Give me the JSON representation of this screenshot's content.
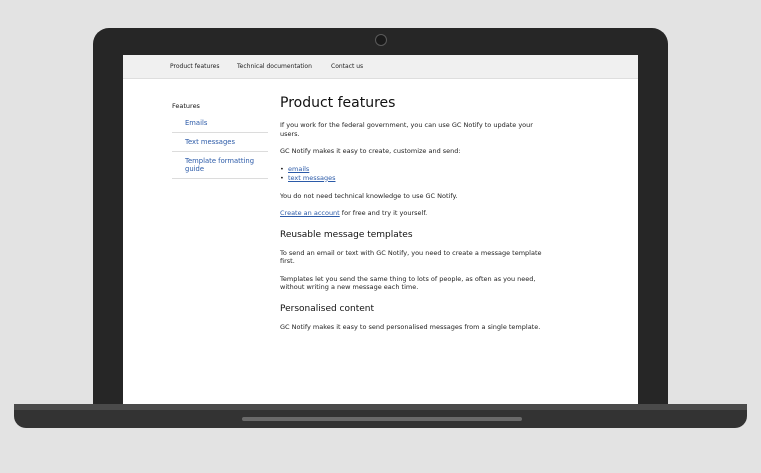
{
  "nav": {
    "items": [
      "Product features",
      "Technical documentation",
      "Contact us"
    ]
  },
  "sidebar": {
    "title": "Features",
    "items": [
      {
        "label": "Emails"
      },
      {
        "label": "Text messages"
      },
      {
        "label": "Template formatting guide"
      }
    ]
  },
  "main": {
    "title": "Product features",
    "intro": "If you work for the federal government, you can use GC Notify to update your users.",
    "makes_easy": "GC Notify makes it easy to create, customize and send:",
    "list": [
      "emails",
      "text messages"
    ],
    "no_knowledge": "You do not need technical knowledge to use GC Notify.",
    "create_account_link": "Create an account",
    "create_account_rest": " for free and try it yourself.",
    "section1_title": "Reusable message templates",
    "section1_p1": "To send an email or text with GC Notify, you need to create a message template first.",
    "section1_p2": "Templates let you send the same thing to lots of people, as often as you need, without writing a new message each time.",
    "section2_title": "Personalised content",
    "section2_p1": "GC Notify makes it easy to send personalised messages from a single template."
  }
}
